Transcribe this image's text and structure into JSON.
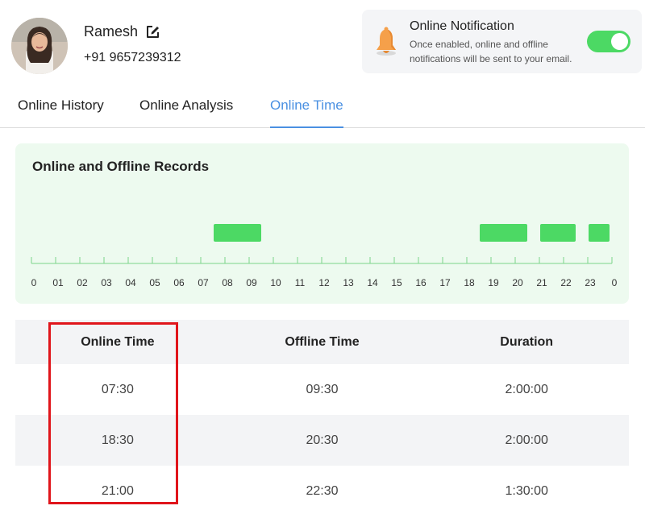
{
  "user": {
    "name": "Ramesh",
    "phone": "+91 9657239312"
  },
  "notification": {
    "title": "Online Notification",
    "description": "Once enabled, online and offline notifications will be sent to your email.",
    "enabled": true,
    "accent": "#4cd964"
  },
  "tabs": [
    {
      "label": "Online History",
      "active": false
    },
    {
      "label": "Online Analysis",
      "active": false
    },
    {
      "label": "Online Time",
      "active": true
    }
  ],
  "tab_accent": "#4a90e2",
  "records": {
    "title": "Online and Offline Records",
    "hour_labels": [
      "0",
      "01",
      "02",
      "03",
      "04",
      "05",
      "06",
      "07",
      "08",
      "09",
      "10",
      "11",
      "12",
      "13",
      "14",
      "15",
      "16",
      "17",
      "18",
      "19",
      "20",
      "21",
      "22",
      "23",
      "0"
    ],
    "online_color": "#4cd964",
    "sessions": [
      {
        "start": 7.5,
        "end": 9.5
      },
      {
        "start": 18.5,
        "end": 20.5
      },
      {
        "start": 21.0,
        "end": 22.5
      },
      {
        "start": 23.0,
        "end": 23.9
      }
    ]
  },
  "table": {
    "headers": [
      "Online Time",
      "Offline Time",
      "Duration"
    ],
    "rows": [
      [
        "07:30",
        "09:30",
        "2:00:00"
      ],
      [
        "18:30",
        "20:30",
        "2:00:00"
      ],
      [
        "21:00",
        "22:30",
        "1:30:00"
      ]
    ]
  },
  "highlight_color": "#e0151b"
}
